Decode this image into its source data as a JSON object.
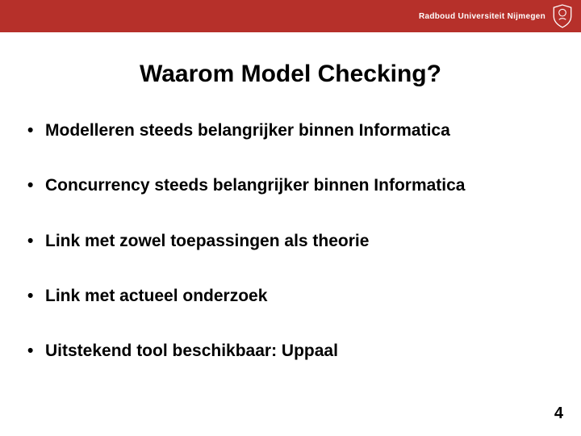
{
  "header": {
    "university": "Radboud Universiteit Nijmegen"
  },
  "title": "Waarom Model Checking?",
  "bullets": [
    "Modelleren steeds belangrijker binnen Informatica",
    "Concurrency steeds belangrijker binnen Informatica",
    "Link met zowel toepassingen als theorie",
    "Link met actueel onderzoek",
    "Uitstekend tool beschikbaar: Uppaal"
  ],
  "page_number": "4"
}
